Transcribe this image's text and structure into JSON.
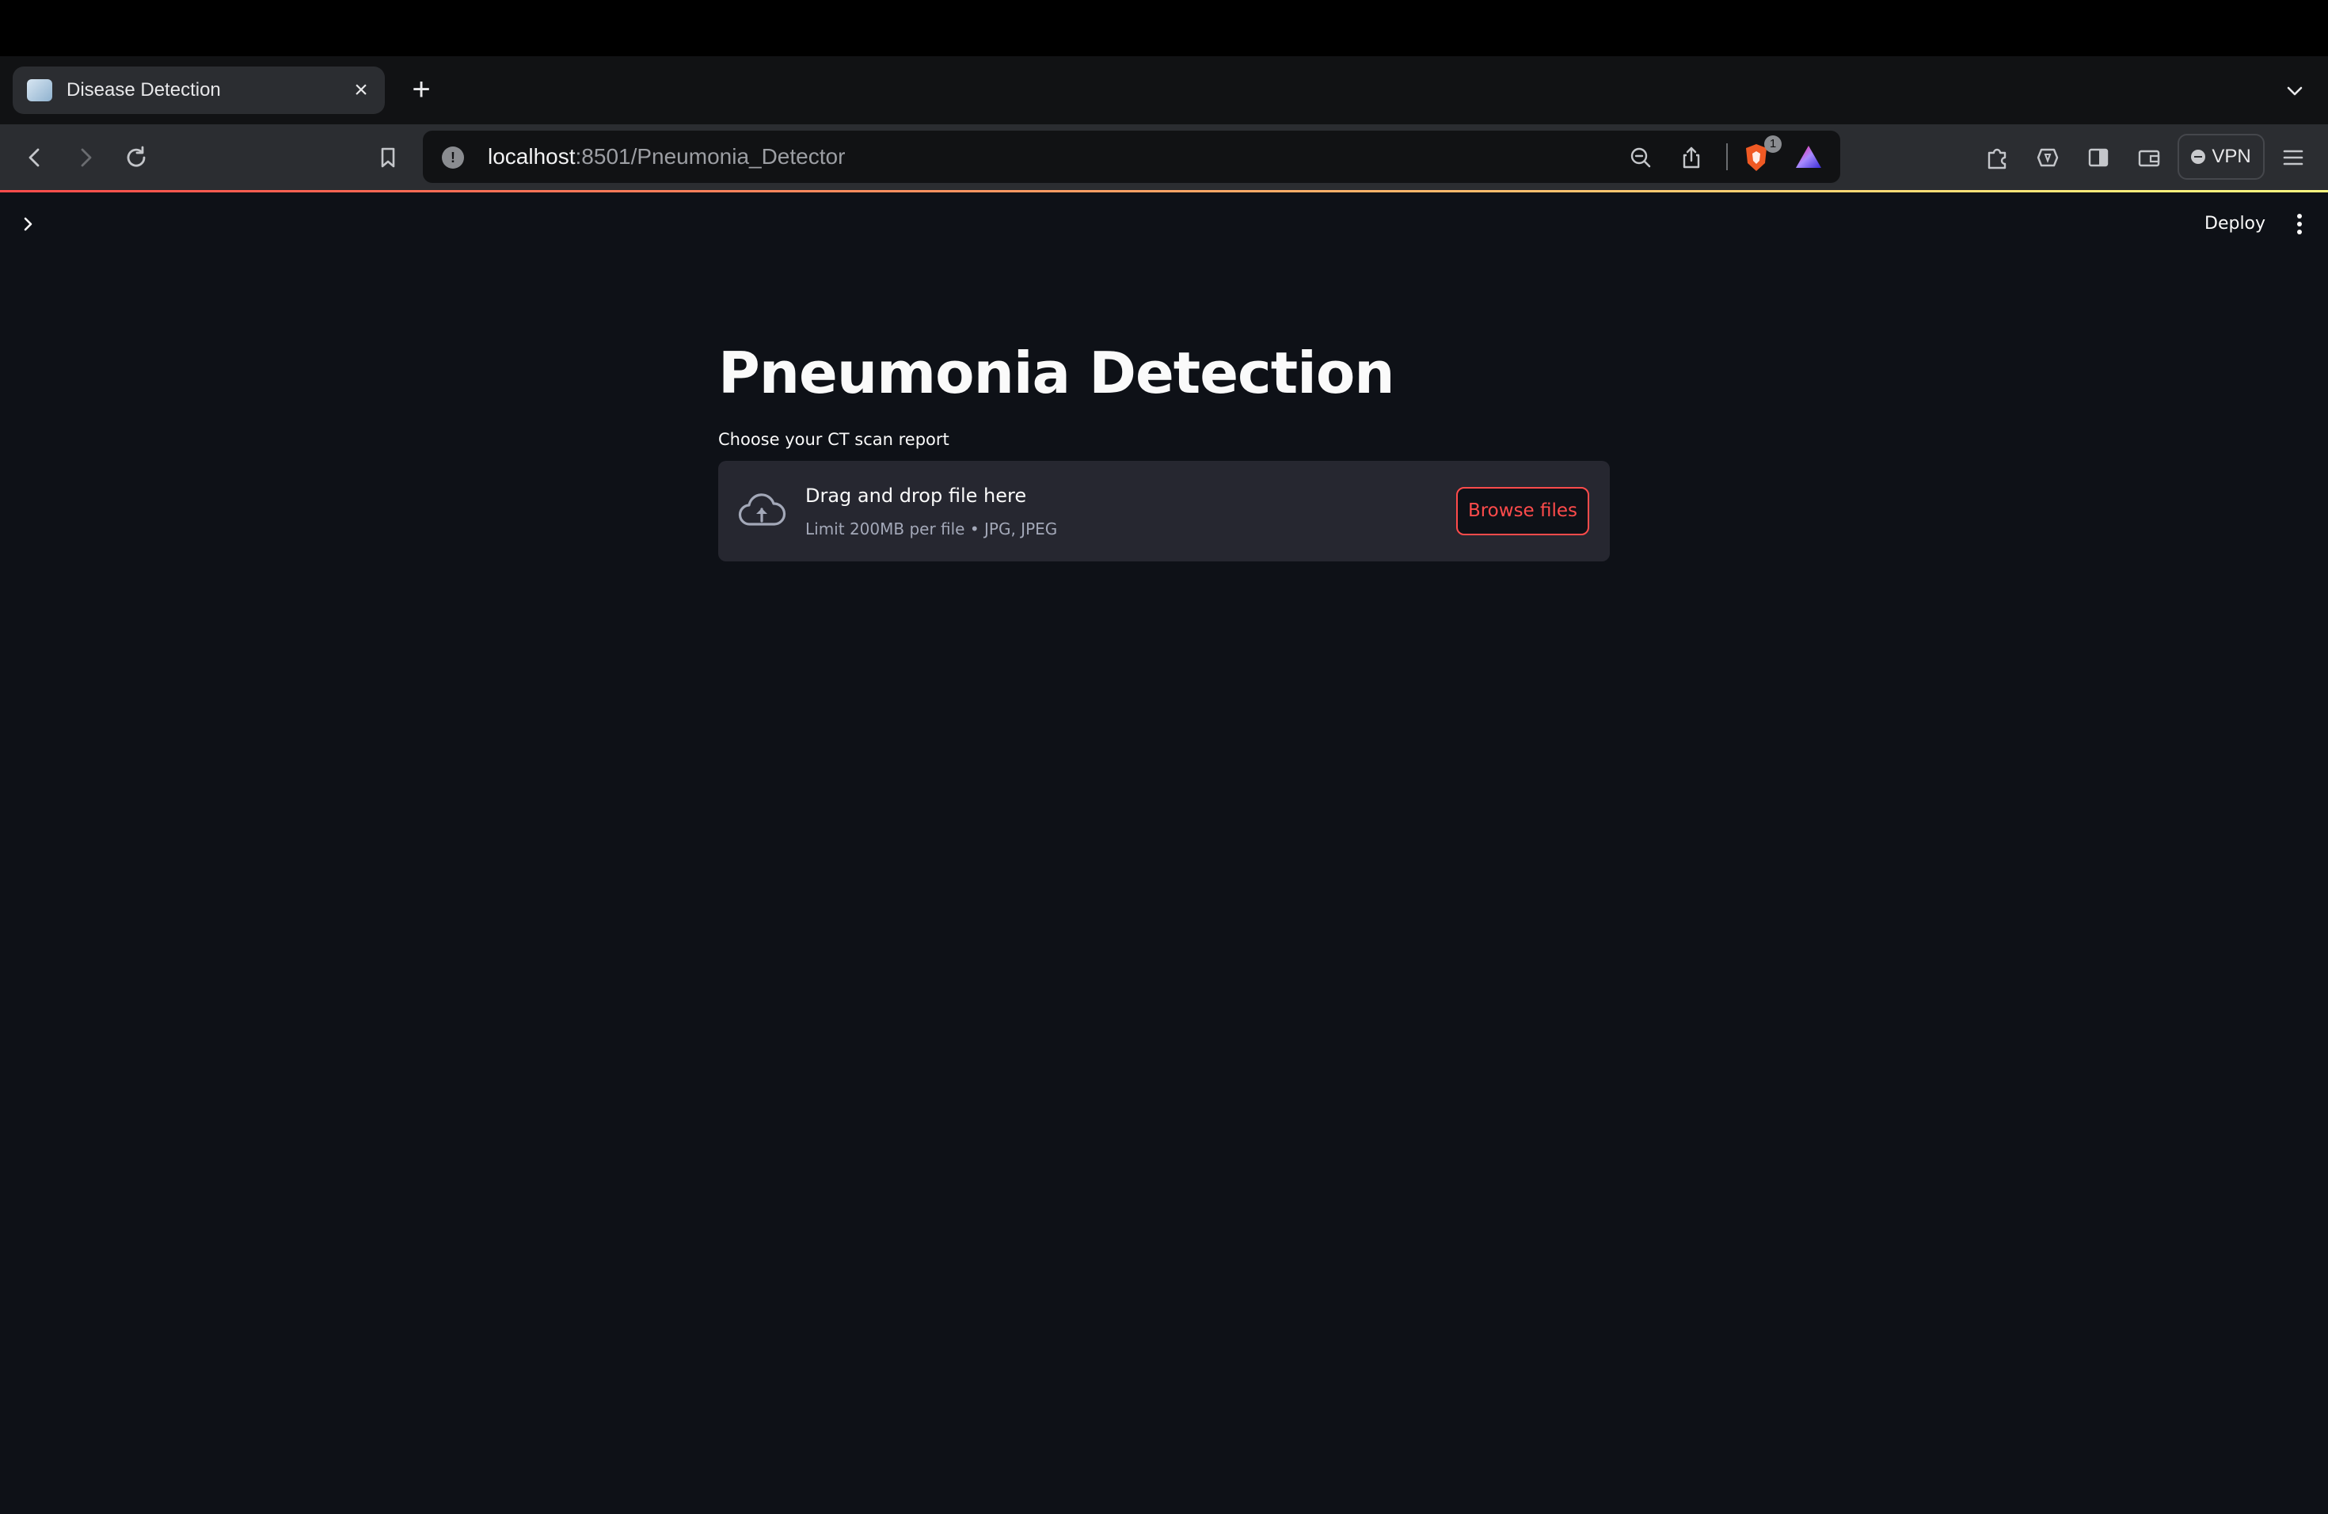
{
  "browser": {
    "tab": {
      "title": "Disease Detection"
    },
    "address_bar": {
      "host": "localhost",
      "path": ":8501/Pneumonia_Detector"
    },
    "brave_shield_count": "1",
    "vpn_label": "VPN"
  },
  "app": {
    "deploy_label": "Deploy",
    "title": "Pneumonia Detection",
    "uploader": {
      "label": "Choose your CT scan report",
      "dropzone_title": "Drag and drop file here",
      "limit_text": "Limit 200MB per file • JPG, JPEG",
      "browse_label": "Browse files"
    }
  },
  "colors": {
    "app_background": "#0e1117",
    "accent": "#ff4b4b",
    "dropzone_background": "#262730"
  },
  "icons": [
    "back-icon",
    "forward-icon",
    "reload-icon",
    "bookmark-icon",
    "site-info-icon",
    "zoom-out-icon",
    "share-icon",
    "brave-shield-icon",
    "brave-rewards-icon",
    "extensions-icon",
    "leo-ai-icon",
    "sidebar-icon",
    "wallet-icon",
    "menu-icon",
    "chevron-right-icon",
    "more-vertical-icon",
    "cloud-upload-icon"
  ]
}
